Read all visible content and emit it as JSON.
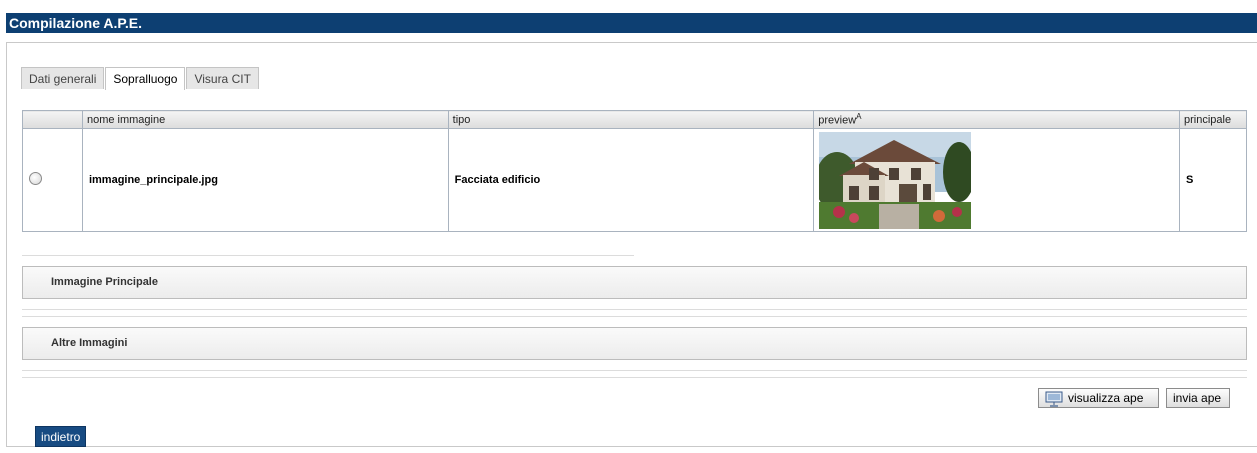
{
  "header": {
    "title": "Compilazione A.P.E."
  },
  "tabs": [
    {
      "label": "Dati generali",
      "active": false
    },
    {
      "label": "Sopralluogo",
      "active": true
    },
    {
      "label": "Visura CIT",
      "active": false
    }
  ],
  "table": {
    "columns": [
      "",
      "nome immagine",
      "tipo",
      "preview",
      "principale"
    ],
    "preview_sup": "A",
    "rows": [
      {
        "selected": false,
        "nome_immagine": "immagine_principale.jpg",
        "tipo": "Facciata edificio",
        "preview_icon": "house-photo",
        "principale": "S"
      }
    ]
  },
  "sections": {
    "immagine_principale": "Immagine Principale",
    "altre_immagini": "Altre Immagini"
  },
  "actions": {
    "visualizza_label": "visualizza ape",
    "invia_label": "invia ape",
    "indietro_label": "indietro"
  },
  "colors": {
    "header_bg": "#0d3f72",
    "primary_button": "#174b82"
  }
}
